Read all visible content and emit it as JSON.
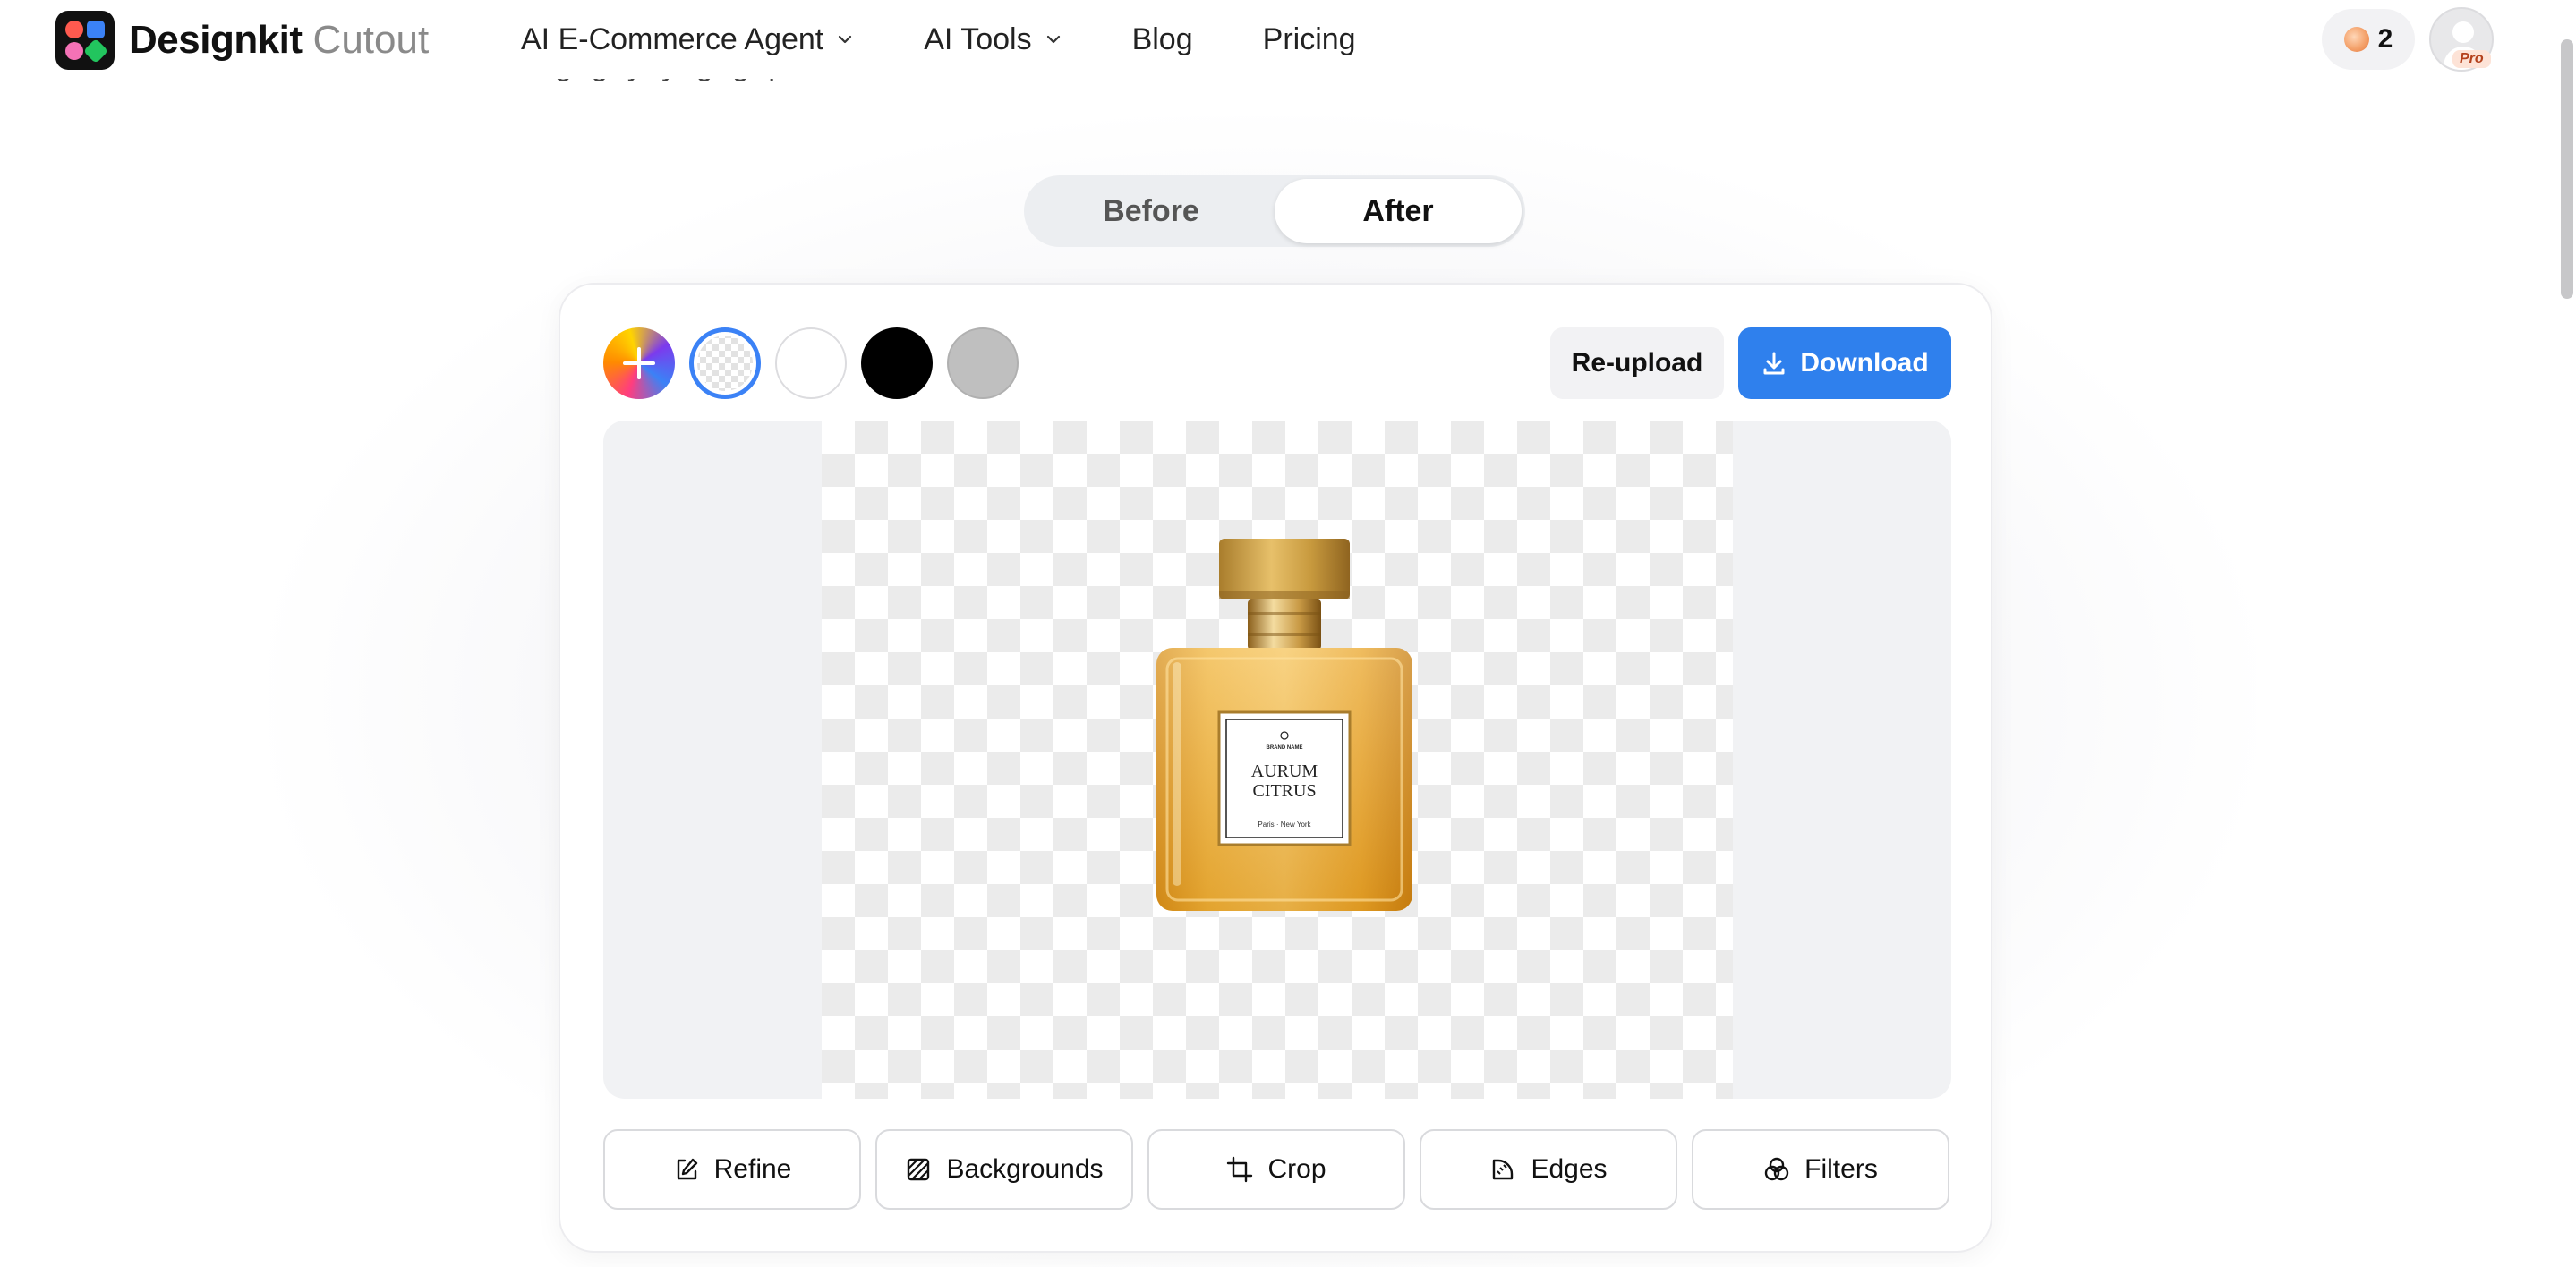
{
  "header": {
    "brand": "Designkit",
    "brand_sub": "Cutout",
    "nav": [
      {
        "label": "AI E-Commerce Agent",
        "has_dropdown": true
      },
      {
        "label": "AI Tools",
        "has_dropdown": true
      },
      {
        "label": "Blog",
        "has_dropdown": false
      },
      {
        "label": "Pricing",
        "has_dropdown": false
      }
    ],
    "credits": "2",
    "pro_badge": "Pro"
  },
  "hero_partial_text": "g                   g             y                     y           g                             g                 p",
  "toggle": {
    "before": "Before",
    "after": "After",
    "selected": "After"
  },
  "editor": {
    "background_swatches": [
      {
        "name": "custom-color",
        "icon": "plus-icon"
      },
      {
        "name": "transparent",
        "selected": true
      },
      {
        "name": "white",
        "color": "#ffffff"
      },
      {
        "name": "black",
        "color": "#000000"
      },
      {
        "name": "gray",
        "color": "#bfbfbf"
      }
    ],
    "reupload_label": "Re-upload",
    "download_label": "Download",
    "product": {
      "brand_small": "BRAND NAME",
      "name_line1": "AURUM",
      "name_line2": "CITRUS",
      "origin": "Paris · New York"
    },
    "tools": [
      {
        "label": "Refine",
        "icon": "edit-icon"
      },
      {
        "label": "Backgrounds",
        "icon": "hatch-icon"
      },
      {
        "label": "Crop",
        "icon": "crop-icon"
      },
      {
        "label": "Edges",
        "icon": "edges-icon"
      },
      {
        "label": "Filters",
        "icon": "filters-icon"
      }
    ]
  },
  "colors": {
    "accent": "#2f80ed",
    "selected_ring": "#3b82f6"
  }
}
